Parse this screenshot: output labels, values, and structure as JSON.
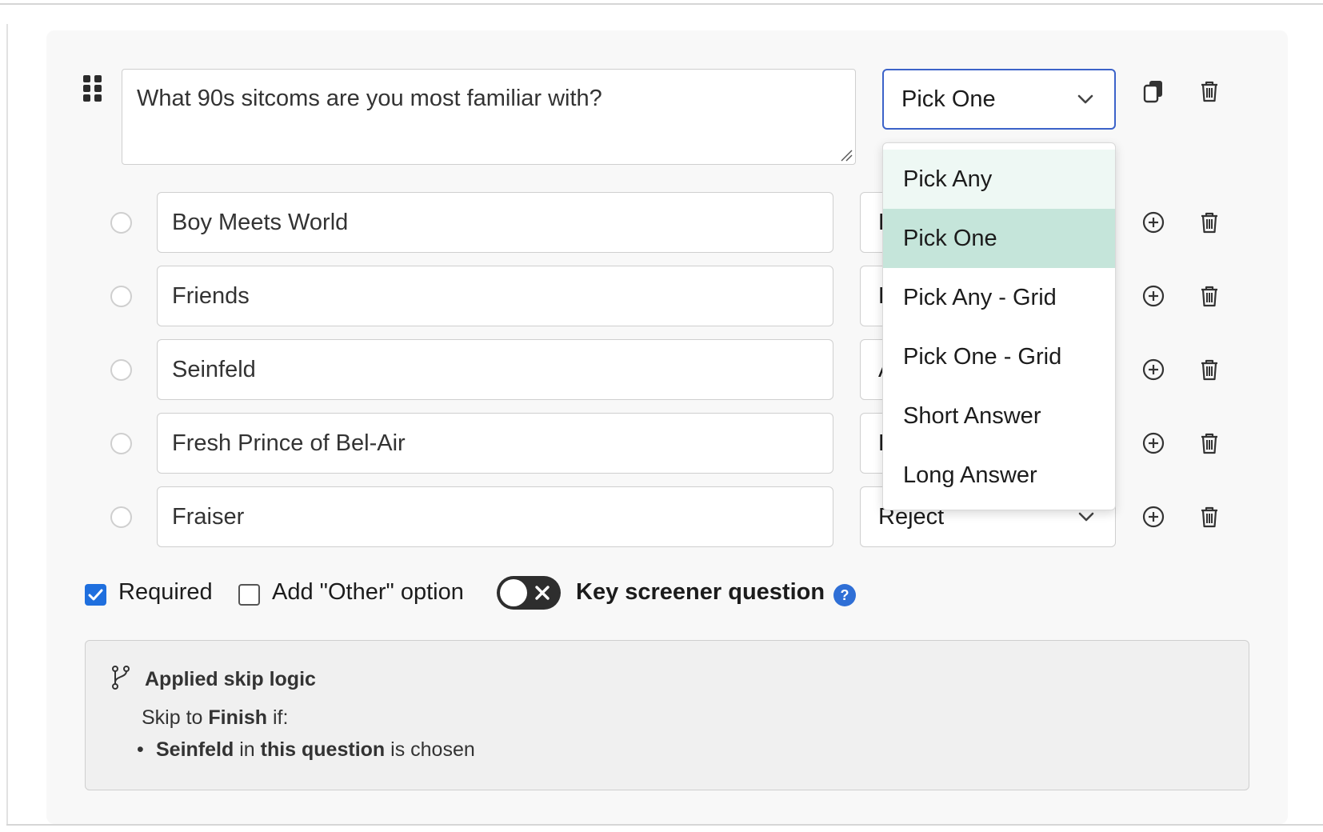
{
  "question": {
    "text": "What 90s sitcoms are you most familiar with?",
    "type_selected": "Pick One"
  },
  "type_menu": {
    "options": [
      "Pick Any",
      "Pick One",
      "Pick Any - Grid",
      "Pick One - Grid",
      "Short Answer",
      "Long Answer"
    ],
    "hovered": "Pick Any",
    "selected": "Pick One"
  },
  "answers": [
    {
      "text": "Boy Meets World",
      "action_visible": "F"
    },
    {
      "text": "Friends",
      "action_visible": "F"
    },
    {
      "text": "Seinfeld",
      "action_visible": "A"
    },
    {
      "text": "Fresh Prince of Bel-Air",
      "action_visible": "F"
    },
    {
      "text": "Fraiser",
      "action_visible": "Reject"
    }
  ],
  "settings": {
    "required_label": "Required",
    "required_checked": true,
    "other_label": "Add \"Other\" option",
    "other_checked": false,
    "key_screener_label": "Key screener question",
    "key_screener_on": false,
    "help_glyph": "?"
  },
  "skip_logic": {
    "title": "Applied skip logic",
    "line_prefix": "Skip to",
    "target": "Finish",
    "line_suffix": "if:",
    "rule_answer": "Seinfeld",
    "rule_mid": "in",
    "rule_scope": "this question",
    "rule_end": "is chosen"
  },
  "icons": {
    "drag": "drag-handle-icon",
    "copy": "copy-icon",
    "delete": "trash-icon",
    "add": "add-circle-icon",
    "chevron": "chevron-down-icon",
    "branch": "branch-icon"
  },
  "colors": {
    "accent": "#3c63c9",
    "checkbox": "#1f6fde",
    "menu_hover": "#eef8f4",
    "menu_selected": "#c5e5da"
  }
}
